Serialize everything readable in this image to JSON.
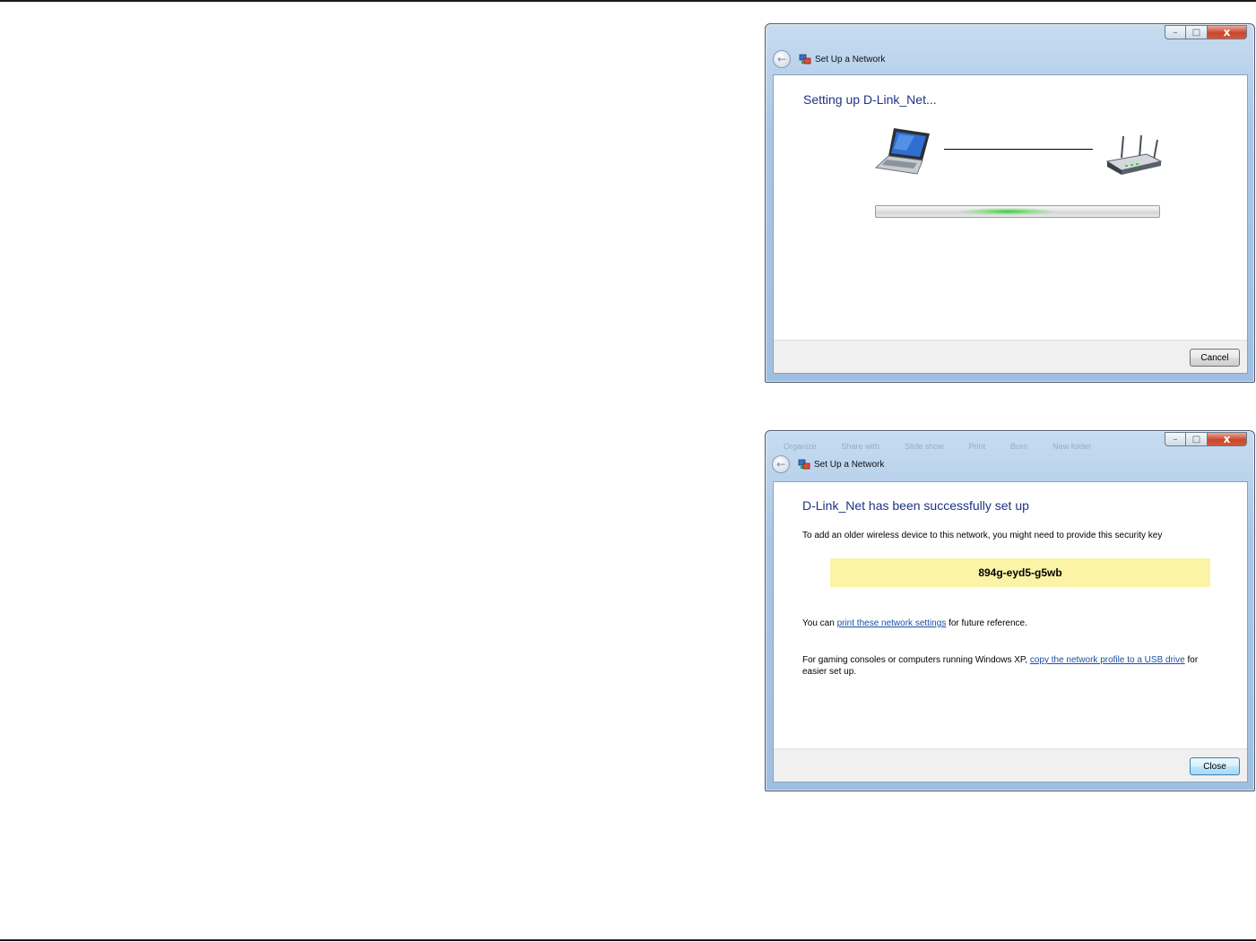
{
  "dialog_setting_up": {
    "window_title": "Set Up a Network",
    "heading": "Setting up D-Link_Net...",
    "progress_indicator": "indeterminate",
    "cancel_label": "Cancel",
    "controls": {
      "minimize": "–",
      "maximize": "□",
      "close": "x"
    },
    "icons": [
      "back-arrow-icon",
      "network-icon",
      "laptop-icon",
      "router-icon"
    ]
  },
  "dialog_success": {
    "window_title": "Set Up a Network",
    "heading": "D-Link_Net has been successfully set up",
    "intro_text": "To add an older wireless device to this network, you might need to provide this security key",
    "security_key": "894g-eyd5-g5wb",
    "print_prefix": "You can ",
    "print_link": "print these network settings",
    "print_suffix": " for future reference.",
    "xp_prefix": "For gaming consoles or computers running Windows XP, ",
    "xp_link": "copy the network profile to a USB drive",
    "xp_suffix": " for easier set up.",
    "close_label": "Close",
    "controls": {
      "minimize": "–",
      "maximize": "□",
      "close": "x"
    },
    "background_menu": [
      "Organize",
      "Share with",
      "Slide show",
      "Print",
      "Burn",
      "New folder"
    ]
  },
  "colors": {
    "heading_blue": "#1e3287",
    "link_blue": "#1a4fa5",
    "key_highlight": "#fbf3a5",
    "progress_green": "#37c737"
  }
}
